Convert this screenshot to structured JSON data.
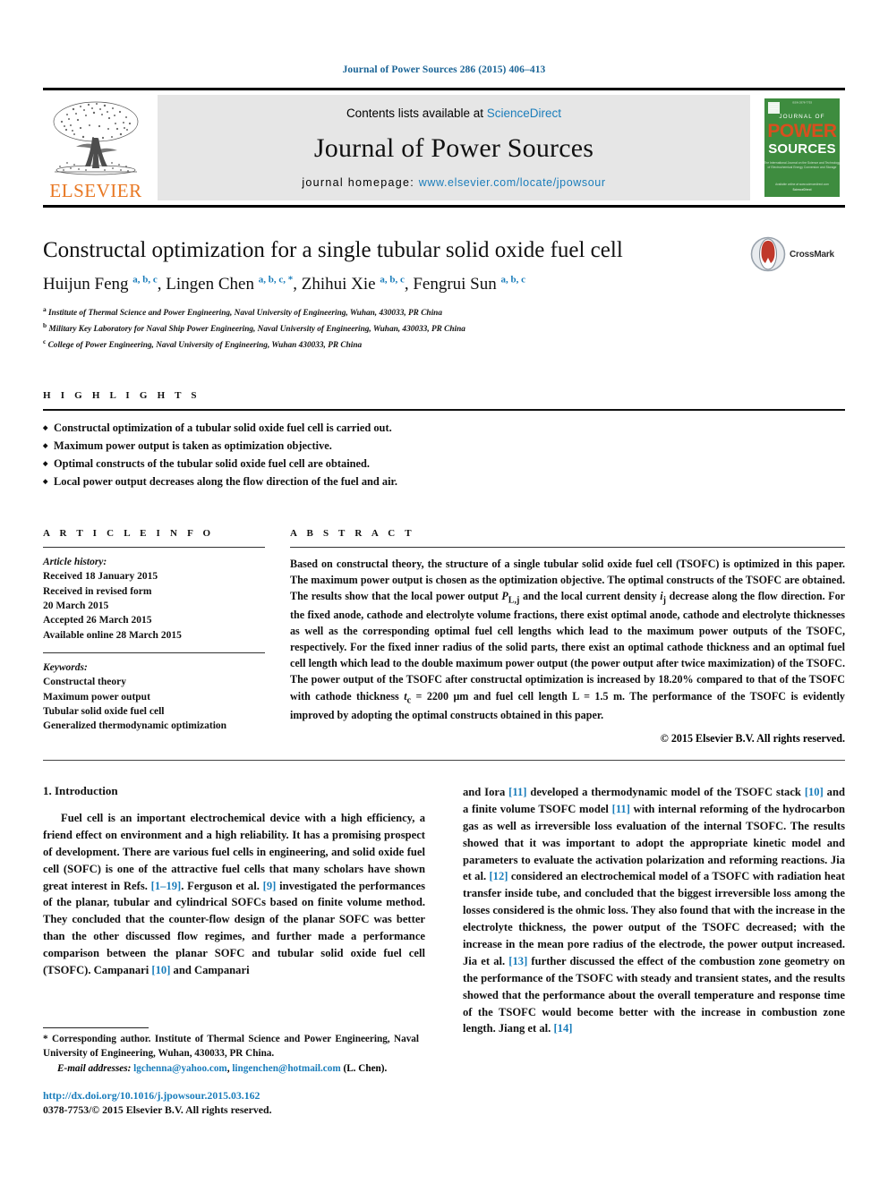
{
  "running_head": "Journal of Power Sources 286 (2015) 406–413",
  "masthead": {
    "contents_prefix": "Contents lists available at ",
    "sciencedirect": "ScienceDirect",
    "journal_title": "Journal of Power Sources",
    "homepage_label": "journal homepage: ",
    "homepage_url": "www.elsevier.com/locate/jpowsour",
    "publisher": "ELSEVIER",
    "cover": {
      "line1": "JOURNAL OF",
      "line2": "POWER",
      "line3": "SOURCES",
      "caption": "An International Journal on the Science and Technology of Electrochemical Energy Conversion and Storage",
      "footer": "Available online at www.sciencedirect.com"
    },
    "link_color": "#1a7dbb",
    "band_color": "#e6e6e6",
    "elsevier_orange": "#E87722",
    "cover_green": "#3e8c3f"
  },
  "article": {
    "title": "Constructal optimization for a single tubular solid oxide fuel cell",
    "authors": [
      {
        "name": "Huijun Feng",
        "sup": "a, b, c"
      },
      {
        "name": "Lingen Chen",
        "sup": "a, b, c, *"
      },
      {
        "name": "Zhihui Xie",
        "sup": "a, b, c"
      },
      {
        "name": "Fengrui Sun",
        "sup": "a, b, c"
      }
    ],
    "affiliations": [
      {
        "mark": "a",
        "text": "Institute of Thermal Science and Power Engineering, Naval University of Engineering, Wuhan, 430033, PR China"
      },
      {
        "mark": "b",
        "text": "Military Key Laboratory for Naval Ship Power Engineering, Naval University of Engineering, Wuhan, 430033, PR China"
      },
      {
        "mark": "c",
        "text": "College of Power Engineering, Naval University of Engineering, Wuhan 430033, PR China"
      }
    ],
    "crossmark_label": "CrossMark"
  },
  "highlights": {
    "heading": "H I G H L I G H T S",
    "items": [
      "Constructal optimization of a tubular solid oxide fuel cell is carried out.",
      "Maximum power output is taken as optimization objective.",
      "Optimal constructs of the tubular solid oxide fuel cell are obtained.",
      "Local power output decreases along the flow direction of the fuel and air."
    ]
  },
  "article_info": {
    "heading": "A R T I C L E   I N F O",
    "history_label": "Article history:",
    "history": [
      "Received 18 January 2015",
      "Received in revised form",
      "20 March 2015",
      "Accepted 26 March 2015",
      "Available online 28 March 2015"
    ],
    "keywords_label": "Keywords:",
    "keywords": [
      "Constructal theory",
      "Maximum power output",
      "Tubular solid oxide fuel cell",
      "Generalized thermodynamic optimization"
    ]
  },
  "abstract": {
    "heading": "A B S T R A C T",
    "p1": "Based on constructal theory, the structure of a single tubular solid oxide fuel cell (TSOFC) is optimized in this paper. The maximum power output is chosen as the optimization objective. The optimal constructs of the TSOFC are obtained. The results show that the local power output ",
    "sym1_base": "P",
    "sym1_sub": "L,j",
    "p2": " and the local current density ",
    "sym2_base": "i",
    "sym2_sub": "j",
    "p3": " decrease along the flow direction. For the fixed anode, cathode and electrolyte volume fractions, there exist optimal anode, cathode and electrolyte thicknesses as well as the corresponding optimal fuel cell lengths which lead to the maximum power outputs of the TSOFC, respectively. For the fixed inner radius of the solid parts, there exist an optimal cathode thickness and an optimal fuel cell length which lead to the double maximum power output (the power output after twice maximization) of the TSOFC. The power output of the TSOFC after constructal optimization is increased by 18.20% compared to that of the TSOFC with cathode thickness ",
    "sym3_base": "t",
    "sym3_sub": "c",
    "p4": " = 2200 μm and fuel cell length L = 1.5 m. The performance of the TSOFC is evidently improved by adopting the optimal constructs obtained in this paper.",
    "copyright": "© 2015 Elsevier B.V. All rights reserved."
  },
  "body": {
    "section_number_title": "1. Introduction",
    "left_para": {
      "t1": "Fuel cell is an important electrochemical device with a high efficiency, a friend effect on environment and a high reliability. It has a promising prospect of development. There are various fuel cells in engineering, and solid oxide fuel cell (SOFC) is one of the attractive fuel cells that many scholars have shown great interest in Refs. ",
      "r1": "[1–19]",
      "t2": ". Ferguson et al. ",
      "r2": "[9]",
      "t3": " investigated the performances of the planar, tubular and cylindrical SOFCs based on finite volume method. They concluded that the counter-flow design of the planar SOFC was better than the other discussed flow regimes, and further made a performance comparison between the planar SOFC and tubular solid oxide fuel cell (TSOFC). Campanari ",
      "r3": "[10]",
      "t4": " and Campanari"
    },
    "right_para": {
      "t1": "and Iora ",
      "r1": "[11]",
      "t2": " developed a thermodynamic model of the TSOFC stack ",
      "r2": "[10]",
      "t3": " and a finite volume TSOFC model ",
      "r3": "[11]",
      "t4": " with internal reforming of the hydrocarbon gas as well as irreversible loss evaluation of the internal TSOFC. The results showed that it was important to adopt the appropriate kinetic model and parameters to evaluate the activation polarization and reforming reactions. Jia et al. ",
      "r4": "[12]",
      "t5": " considered an electrochemical model of a TSOFC with radiation heat transfer inside tube, and concluded that the biggest irreversible loss among the losses considered is the ohmic loss. They also found that with the increase in the electrolyte thickness, the power output of the TSOFC decreased; with the increase in the mean pore radius of the electrode, the power output increased. Jia et al. ",
      "r5": "[13]",
      "t6": " further discussed the effect of the combustion zone geometry on the performance of the TSOFC with steady and transient states, and the results showed that the performance about the overall temperature and response time of the TSOFC would become better with the increase in combustion zone length. Jiang et al. ",
      "r6": "[14]",
      "t7": ""
    }
  },
  "footer": {
    "corresponding_star": "*",
    "corresponding_text": " Corresponding author. Institute of Thermal Science and Power Engineering, Naval University of Engineering, Wuhan, 430033, PR China.",
    "email_label": "E-mail addresses:",
    "email1": "lgchenna@yahoo.com",
    "email_sep": ", ",
    "email2": "lingenchen@hotmail.com",
    "email_suffix": " (L. Chen).",
    "doi": "http://dx.doi.org/10.1016/j.jpowsour.2015.03.162",
    "issn_line": "0378-7753/© 2015 Elsevier B.V. All rights reserved."
  }
}
